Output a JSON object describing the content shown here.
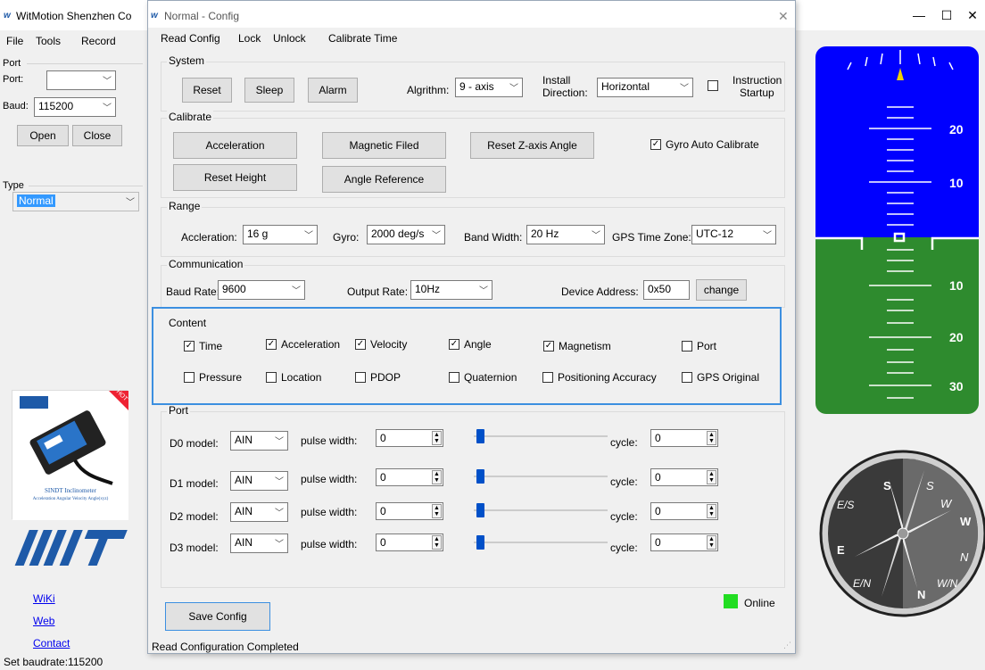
{
  "main_window": {
    "title": "WitMotion Shenzhen Co",
    "menu": {
      "file": "File",
      "tools": "Tools",
      "record": "Record"
    },
    "port_group": "Port",
    "port_label": "Port:",
    "port_value": "",
    "baud_label": "Baud:",
    "baud_value": "115200",
    "open_button": "Open",
    "close_button": "Close",
    "type_group": "Type",
    "type_value": "Normal",
    "product_caption": "SINDT Inclinometer",
    "product_subcaption": "Acceleration Angular Velocity Angle(xyz)",
    "product_badge": "HOT",
    "links": {
      "wiki": "WiKi",
      "web": "Web",
      "contact": "Contact"
    },
    "status": "Set baudrate:115200"
  },
  "instruments": {
    "attitude_scale_upper": [
      "20",
      "10"
    ],
    "attitude_scale_lower": [
      "10",
      "20",
      "30"
    ],
    "sky_color": "#0000ff",
    "ground_color": "#2e8b2e",
    "compass_letters": [
      "S",
      "S",
      "W",
      "W",
      "N",
      "N",
      "E",
      "E/S",
      "W/N",
      "E/N"
    ]
  },
  "dialog": {
    "title": "Normal - Config",
    "menu": {
      "read_config": "Read Config",
      "lock": "Lock",
      "unlock": "Unlock",
      "calibrate_time": "Calibrate Time"
    },
    "system": {
      "group": "System",
      "reset": "Reset",
      "sleep": "Sleep",
      "alarm": "Alarm",
      "algrithm_label": "Algrithm:",
      "algrithm_value": "9 - axis",
      "install_label_1": "Install",
      "install_label_2": "Direction:",
      "install_value": "Horizontal",
      "instruction_label_1": "Instruction",
      "instruction_label_2": "Startup",
      "instruction_checked": false
    },
    "calibrate": {
      "group": "Calibrate",
      "acceleration": "Acceleration",
      "magnetic": "Magnetic Filed",
      "reset_z": "Reset Z-axis Angle",
      "gyro_auto": "Gyro Auto Calibrate",
      "gyro_auto_checked": true,
      "reset_height": "Reset Height",
      "angle_reference": "Angle Reference"
    },
    "range": {
      "group": "Range",
      "accel_label": "Accleration:",
      "accel_value": "16 g",
      "gyro_label": "Gyro:",
      "gyro_value": "2000 deg/s",
      "bandwidth_label": "Band Width:",
      "bandwidth_value": "20  Hz",
      "gps_tz_label": "GPS Time Zone:",
      "gps_tz_value": "UTC-12"
    },
    "communication": {
      "group": "Communication",
      "baud_label": "Baud Rate:",
      "baud_value": "9600",
      "output_label": "Output Rate:",
      "output_value": "10Hz",
      "address_label": "Device Address:",
      "address_value": "0x50",
      "change": "change"
    },
    "content": {
      "group": "Content",
      "items": [
        {
          "label": "Time",
          "checked": true
        },
        {
          "label": "Acceleration",
          "checked": true
        },
        {
          "label": "Velocity",
          "checked": true
        },
        {
          "label": "Angle",
          "checked": true
        },
        {
          "label": "Magnetism",
          "checked": true
        },
        {
          "label": "Port",
          "checked": false
        },
        {
          "label": "Pressure",
          "checked": false
        },
        {
          "label": "Location",
          "checked": false
        },
        {
          "label": "PDOP",
          "checked": false
        },
        {
          "label": "Quaternion",
          "checked": false
        },
        {
          "label": "Positioning Accuracy",
          "checked": false
        },
        {
          "label": "GPS Original",
          "checked": false
        }
      ]
    },
    "port": {
      "group": "Port",
      "rows": [
        {
          "model_label": "D0 model:",
          "model_value": "AIN",
          "pulse_label": "pulse width:",
          "pulse_value": "0",
          "cycle_label": "cycle:",
          "cycle_value": "0"
        },
        {
          "model_label": "D1 model:",
          "model_value": "AIN",
          "pulse_label": "pulse width:",
          "pulse_value": "0",
          "cycle_label": "cycle:",
          "cycle_value": "0"
        },
        {
          "model_label": "D2 model:",
          "model_value": "AIN",
          "pulse_label": "pulse width:",
          "pulse_value": "0",
          "cycle_label": "cycle:",
          "cycle_value": "0"
        },
        {
          "model_label": "D3 model:",
          "model_value": "AIN",
          "pulse_label": "pulse width:",
          "pulse_value": "0",
          "cycle_label": "cycle:",
          "cycle_value": "0"
        }
      ]
    },
    "save_config": "Save Config",
    "online": "Online",
    "online_color": "#22dd22",
    "status": "Read Configuration Completed"
  }
}
